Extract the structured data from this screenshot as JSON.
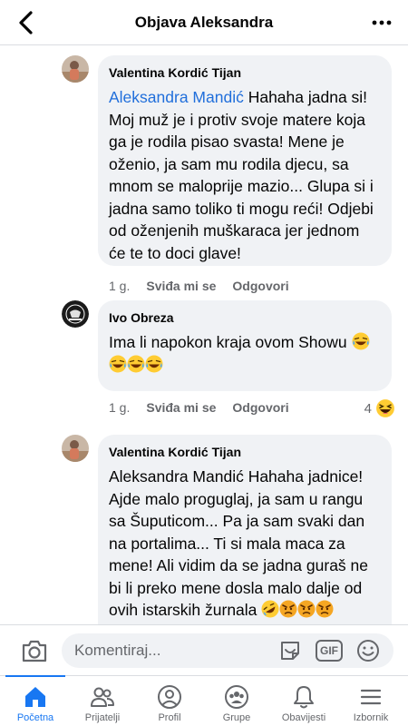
{
  "header": {
    "title": "Objava Aleksandra",
    "back_icon": "chevron-left-icon",
    "more_icon": "more-horizontal-icon"
  },
  "comments": [
    {
      "author": "Valentina Kordić Tijan",
      "mention": "Aleksandra Mandić",
      "text": "Hahaha jadna si! Moj muž je i protiv svoje matere koja ga je rodila pisao svasta! Mene je oženio, ja sam mu rodila djecu, sa mnom se maloprije mazio... Glupa si i jadna samo toliko ti mogu reći! Odjebi od oženjenih muškaraca jer jednom će te to doci glave!",
      "time": "1 g.",
      "like": "Sviđa mi se",
      "reply": "Odgovori"
    },
    {
      "author": "Ivo Obreza",
      "text": "Ima li napokon kraja ovom Showu",
      "emojis": [
        "laughing-tears",
        "laughing-tears",
        "laughing-tears",
        "laughing-tears"
      ],
      "time": "1 g.",
      "like": "Sviđa mi se",
      "reply": "Odgovori",
      "reaction_count": "4",
      "reaction_icon": "haha-reaction-icon"
    },
    {
      "author": "Valentina Kordić Tijan",
      "text": "Aleksandra Mandić Hahaha jadnice! Ajde malo proguglaj, ja sam u rangu sa Šuputicom... Pa ja sam svaki dan na portalima... Ti si mala maca za mene! Ali vidim da se jadna guraš ne bi li preko mene dosla malo dalje od ovih istarskih žurnala",
      "emojis": [
        "rolling-laughing",
        "angry",
        "angry",
        "angry"
      ]
    }
  ],
  "composer": {
    "placeholder": "Komentiraj...",
    "gif_label": "GIF"
  },
  "tabs": [
    {
      "label": "Početna",
      "icon": "home-icon",
      "active": true
    },
    {
      "label": "Prijatelji",
      "icon": "friends-icon"
    },
    {
      "label": "Profil",
      "icon": "profile-icon"
    },
    {
      "label": "Grupe",
      "icon": "groups-icon"
    },
    {
      "label": "Obavijesti",
      "icon": "bell-icon"
    },
    {
      "label": "Izbornik",
      "icon": "menu-icon"
    }
  ],
  "colors": {
    "accent": "#1877f2",
    "mention": "#216fdb",
    "bubble": "#f0f2f5",
    "secondary_text": "#65676b"
  }
}
